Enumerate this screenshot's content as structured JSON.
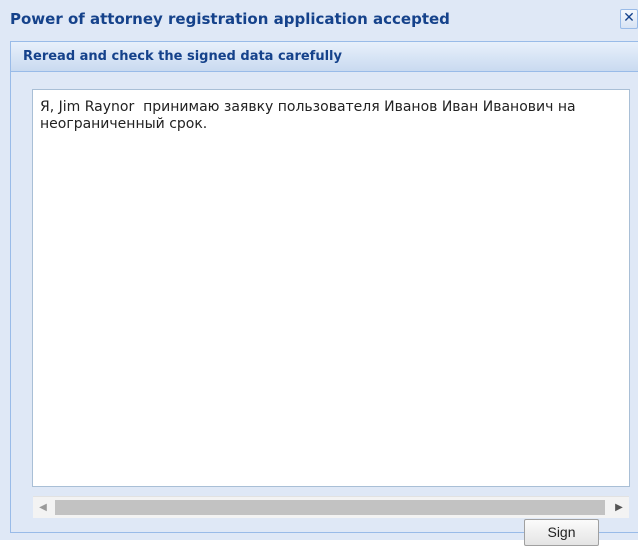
{
  "window": {
    "title": "Power of attorney registration application accepted",
    "close_icon": "close-icon",
    "close_glyph": "✕"
  },
  "panel": {
    "header": "Reread and check the signed data carefully"
  },
  "content": {
    "text": "Я, Jim Raynor  принимаю заявку пользователя Иванов Иван Иванович на неограниченный срок."
  },
  "scrollbar": {
    "left_arrow": "◀",
    "right_arrow": "▶"
  },
  "actions": {
    "sign_label": "Sign"
  },
  "colors": {
    "title_text": "#15428b",
    "dialog_bg": "#dfe8f6",
    "border": "#99bbe8"
  }
}
